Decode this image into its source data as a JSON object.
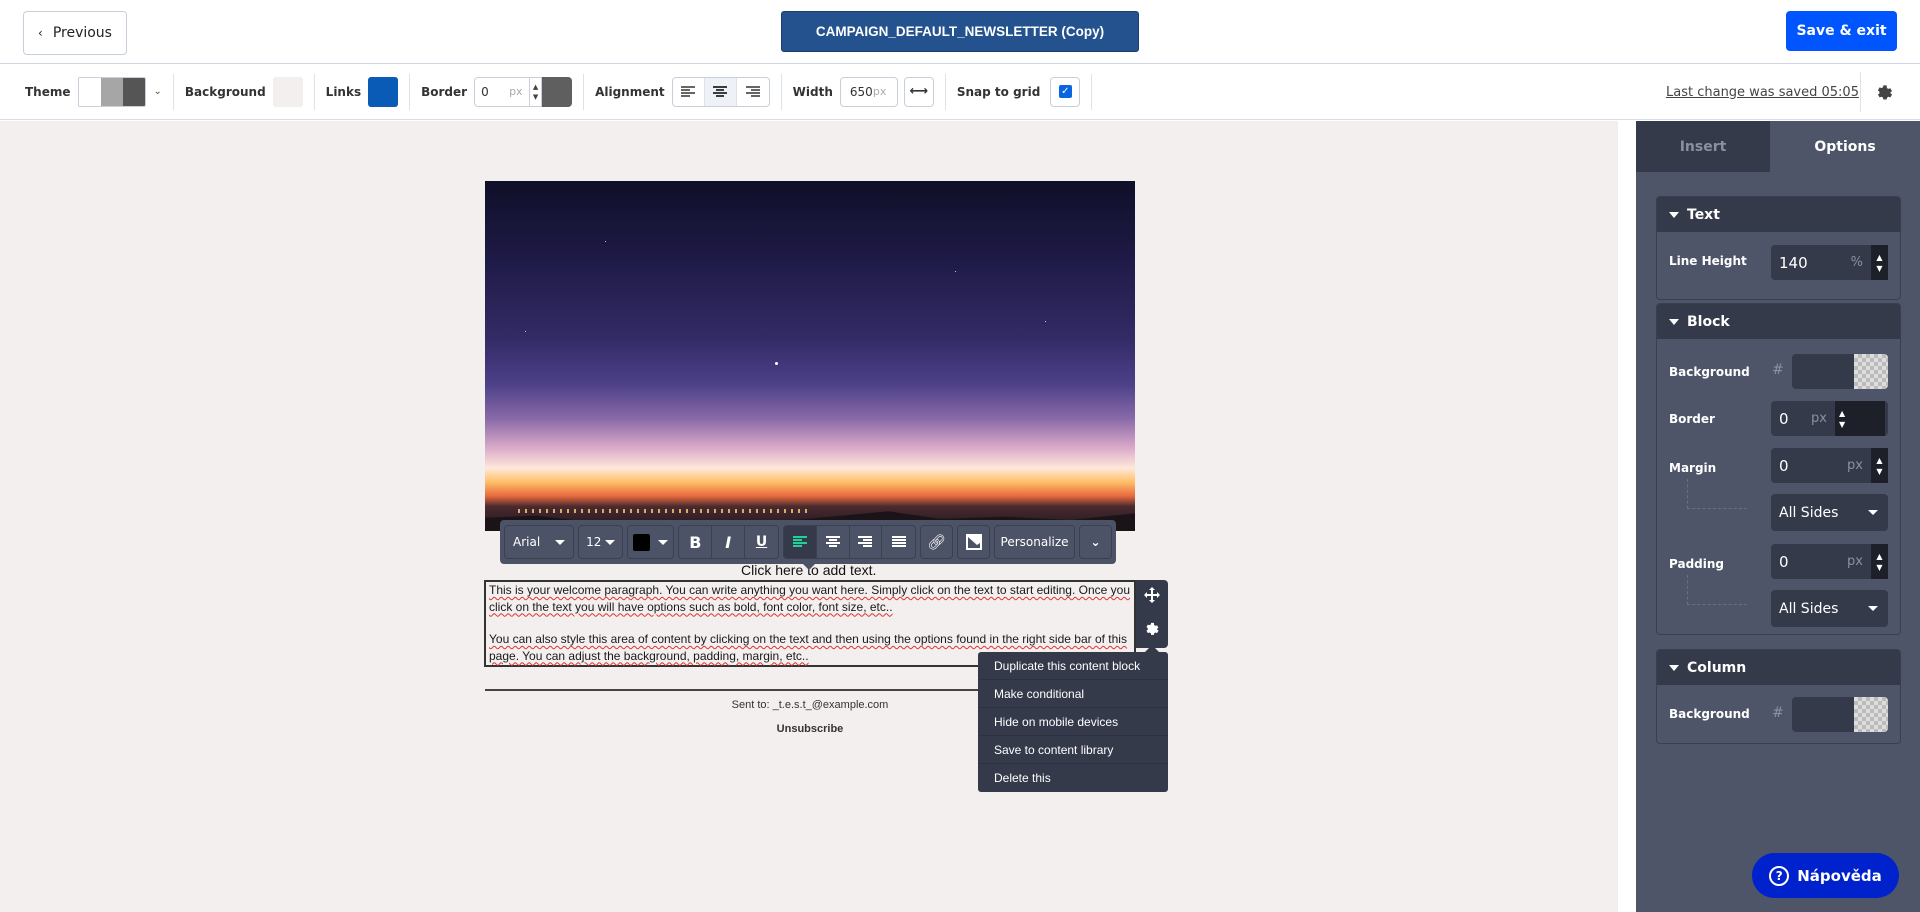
{
  "header": {
    "previous_label": "Previous",
    "campaign_title": "CAMPAIGN_DEFAULT_NEWSLETTER (Copy)",
    "save_exit_label": "Save & exit"
  },
  "toolbar": {
    "theme_label": "Theme",
    "theme_colors": [
      "#ffffff",
      "#a6a6a6",
      "#555555"
    ],
    "background_label": "Background",
    "background_color": "#f2efee",
    "links_label": "Links",
    "links_color": "#0a5bb5",
    "border_label": "Border",
    "border_value": "0",
    "border_unit": "px",
    "border_color": "#5f5f5f",
    "alignment_label": "Alignment",
    "alignment_options": [
      "left",
      "center",
      "right"
    ],
    "alignment_selected": "center",
    "width_label": "Width",
    "width_value": "650",
    "width_unit": "px",
    "snap_label": "Snap to grid",
    "snap_checked": true,
    "last_saved": "Last change was saved 05:05"
  },
  "editor": {
    "hint_text": "Click here to add text.",
    "paragraph1": "This is your welcome paragraph. You can write anything you want here. Simply click on the text to start editing. Once you click on the text you will have options such as bold, font color, font size, etc..",
    "paragraph2": "You can also style this area of content by clicking on the text and then using the options found in the right side bar of this page. You can adjust the background, padding, margin, etc..",
    "sent_to": "Sent to: _t.e.s.t_@example.com",
    "unsubscribe": "Unsubscribe"
  },
  "text_toolbar": {
    "font": "Arial",
    "size": "12",
    "text_color": "#000000",
    "personalize_label": "Personalize",
    "active_align": "left",
    "accent_color": "#1fd19a"
  },
  "context_menu": {
    "items": [
      "Duplicate this content block",
      "Make conditional",
      "Hide on mobile devices",
      "Save to content library",
      "Delete this"
    ]
  },
  "panel": {
    "tabs": [
      "Insert",
      "Options"
    ],
    "active_tab": "Options",
    "text_section": {
      "title": "Text",
      "line_height_label": "Line Height",
      "line_height_value": "140",
      "line_height_unit": "%"
    },
    "block_section": {
      "title": "Block",
      "background_label": "Background",
      "hash": "#",
      "border_label": "Border",
      "border_value": "0",
      "border_unit": "px",
      "margin_label": "Margin",
      "margin_value": "0",
      "margin_unit": "px",
      "margin_sides": "All Sides",
      "padding_label": "Padding",
      "padding_value": "0",
      "padding_unit": "px",
      "padding_sides": "All Sides"
    },
    "column_section": {
      "title": "Column",
      "background_label": "Background",
      "hash": "#"
    }
  },
  "help_button": {
    "label": "Nápověda"
  }
}
